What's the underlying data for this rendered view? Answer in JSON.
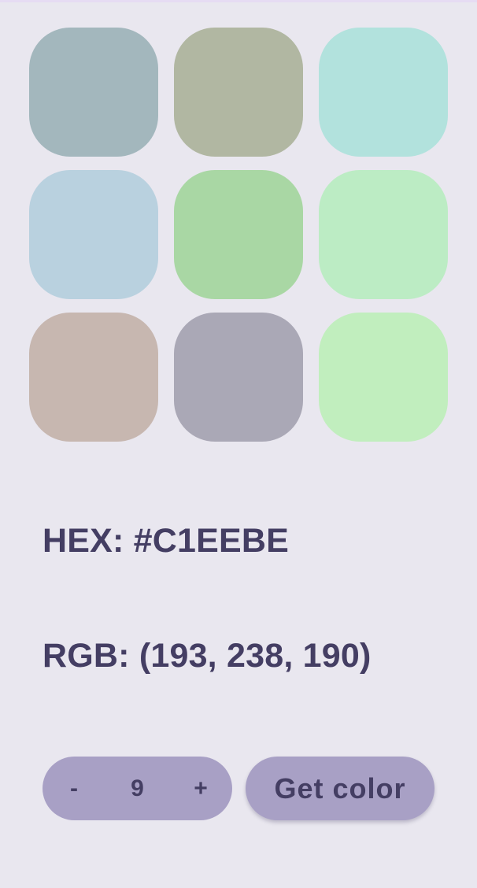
{
  "palette": {
    "swatches": [
      {
        "color": "#a3b7bd"
      },
      {
        "color": "#b1b7a2"
      },
      {
        "color": "#b2e2dd"
      },
      {
        "color": "#b9d1df"
      },
      {
        "color": "#a9d7a4"
      },
      {
        "color": "#bcecc4"
      },
      {
        "color": "#c7b7b0"
      },
      {
        "color": "#aaa8b6"
      },
      {
        "color": "#c1eebe"
      }
    ]
  },
  "info": {
    "hex_text": "HEX: #C1EEBE",
    "rgb_text": "RGB: (193, 238, 190)"
  },
  "stepper": {
    "minus_label": "-",
    "value": "9",
    "plus_label": "+"
  },
  "actions": {
    "get_color_label": "Get color"
  },
  "theme": {
    "background": "#e9e7ef",
    "button": "#a8a0c5",
    "text": "#443e63"
  }
}
